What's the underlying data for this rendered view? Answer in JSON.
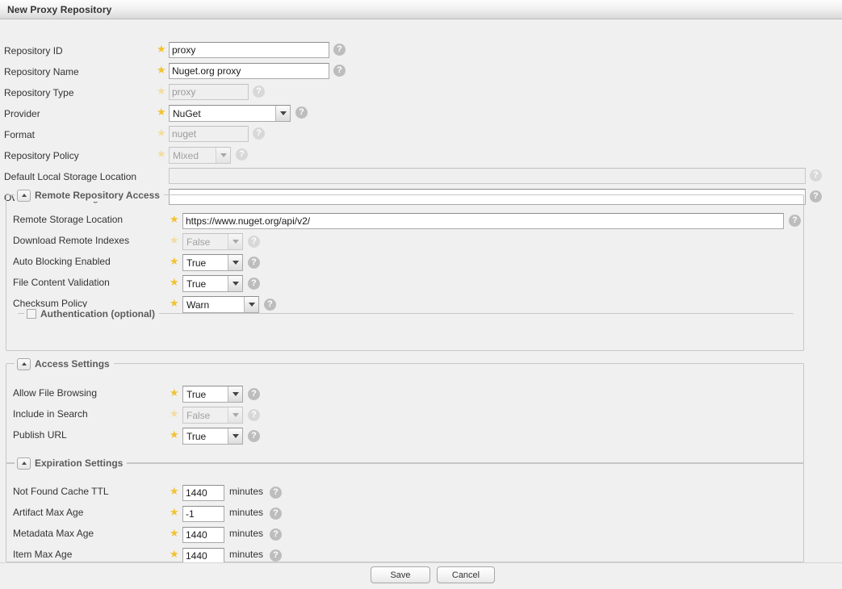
{
  "window": {
    "title": "New Proxy Repository"
  },
  "icons": {
    "help": "?",
    "required_star": "star-icon",
    "collapse": "collapse-up-icon"
  },
  "main_fields": [
    {
      "label": "Repository ID",
      "value": "proxy",
      "control": "text",
      "enabled": true,
      "required": true
    },
    {
      "label": "Repository Name",
      "value": "Nuget.org proxy",
      "control": "text",
      "enabled": true,
      "required": true
    },
    {
      "label": "Repository Type",
      "value": "proxy",
      "control": "text",
      "enabled": false,
      "required": true
    },
    {
      "label": "Provider",
      "value": "NuGet",
      "control": "select",
      "enabled": true,
      "required": true
    },
    {
      "label": "Format",
      "value": "nuget",
      "control": "text",
      "enabled": false,
      "required": true
    },
    {
      "label": "Repository Policy",
      "value": "Mixed",
      "control": "select",
      "enabled": false,
      "required": true
    },
    {
      "label": "Default Local Storage Location",
      "value": "",
      "control": "text",
      "enabled": false,
      "required": false
    },
    {
      "label": "Override Local Storage Location",
      "value": "",
      "control": "text",
      "enabled": true,
      "required": false
    }
  ],
  "remote_section": {
    "legend": "Remote Repository Access",
    "fields": [
      {
        "label": "Remote Storage Location",
        "value": "https://www.nuget.org/api/v2/",
        "control": "text",
        "enabled": true,
        "required": true
      },
      {
        "label": "Download Remote Indexes",
        "value": "False",
        "control": "select",
        "enabled": false,
        "required": true
      },
      {
        "label": "Auto Blocking Enabled",
        "value": "True",
        "control": "select",
        "enabled": true,
        "required": true
      },
      {
        "label": "File Content Validation",
        "value": "True",
        "control": "select",
        "enabled": true,
        "required": true
      },
      {
        "label": "Checksum Policy",
        "value": "Warn",
        "control": "select",
        "enabled": true,
        "required": true
      }
    ],
    "auth_legend": "Authentication (optional)",
    "auth_checked": false
  },
  "access_section": {
    "legend": "Access Settings",
    "fields": [
      {
        "label": "Allow File Browsing",
        "value": "True",
        "control": "select",
        "enabled": true,
        "required": true
      },
      {
        "label": "Include in Search",
        "value": "False",
        "control": "select",
        "enabled": false,
        "required": true
      },
      {
        "label": "Publish URL",
        "value": "True",
        "control": "select",
        "enabled": true,
        "required": true
      }
    ]
  },
  "expiration_section": {
    "legend": "Expiration Settings",
    "units": "minutes",
    "fields": [
      {
        "label": "Not Found Cache TTL",
        "value": "1440",
        "control": "text",
        "enabled": true,
        "required": true
      },
      {
        "label": "Artifact Max Age",
        "value": "-1",
        "control": "text",
        "enabled": true,
        "required": true
      },
      {
        "label": "Metadata Max Age",
        "value": "1440",
        "control": "text",
        "enabled": true,
        "required": true
      },
      {
        "label": "Item Max Age",
        "value": "1440",
        "control": "text",
        "enabled": true,
        "required": true
      }
    ]
  },
  "buttons": {
    "save": "Save",
    "cancel": "Cancel"
  },
  "colors": {
    "required_star": "#f2c230",
    "help_icon": "#bdbdbd",
    "panel_bg": "#f0f0f0",
    "legend_text": "#5b5b5b"
  }
}
